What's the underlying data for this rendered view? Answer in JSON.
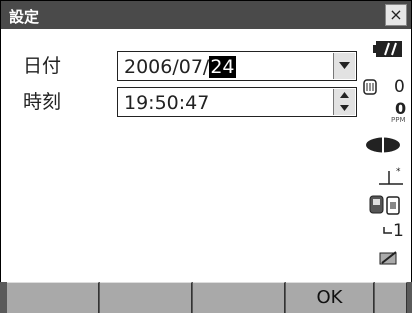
{
  "window": {
    "title": "設定",
    "close_label": "×"
  },
  "form": {
    "date": {
      "label": "日付",
      "value_prefix": "2006/07/",
      "value_selected": "24"
    },
    "time": {
      "label": "時刻",
      "value": "19:50:47"
    }
  },
  "status": {
    "atm_value": "0",
    "ppm_value": "0",
    "ppm_label": "PPM",
    "face_value": "1"
  },
  "softkeys": [
    "",
    "",
    "",
    "OK",
    ""
  ]
}
